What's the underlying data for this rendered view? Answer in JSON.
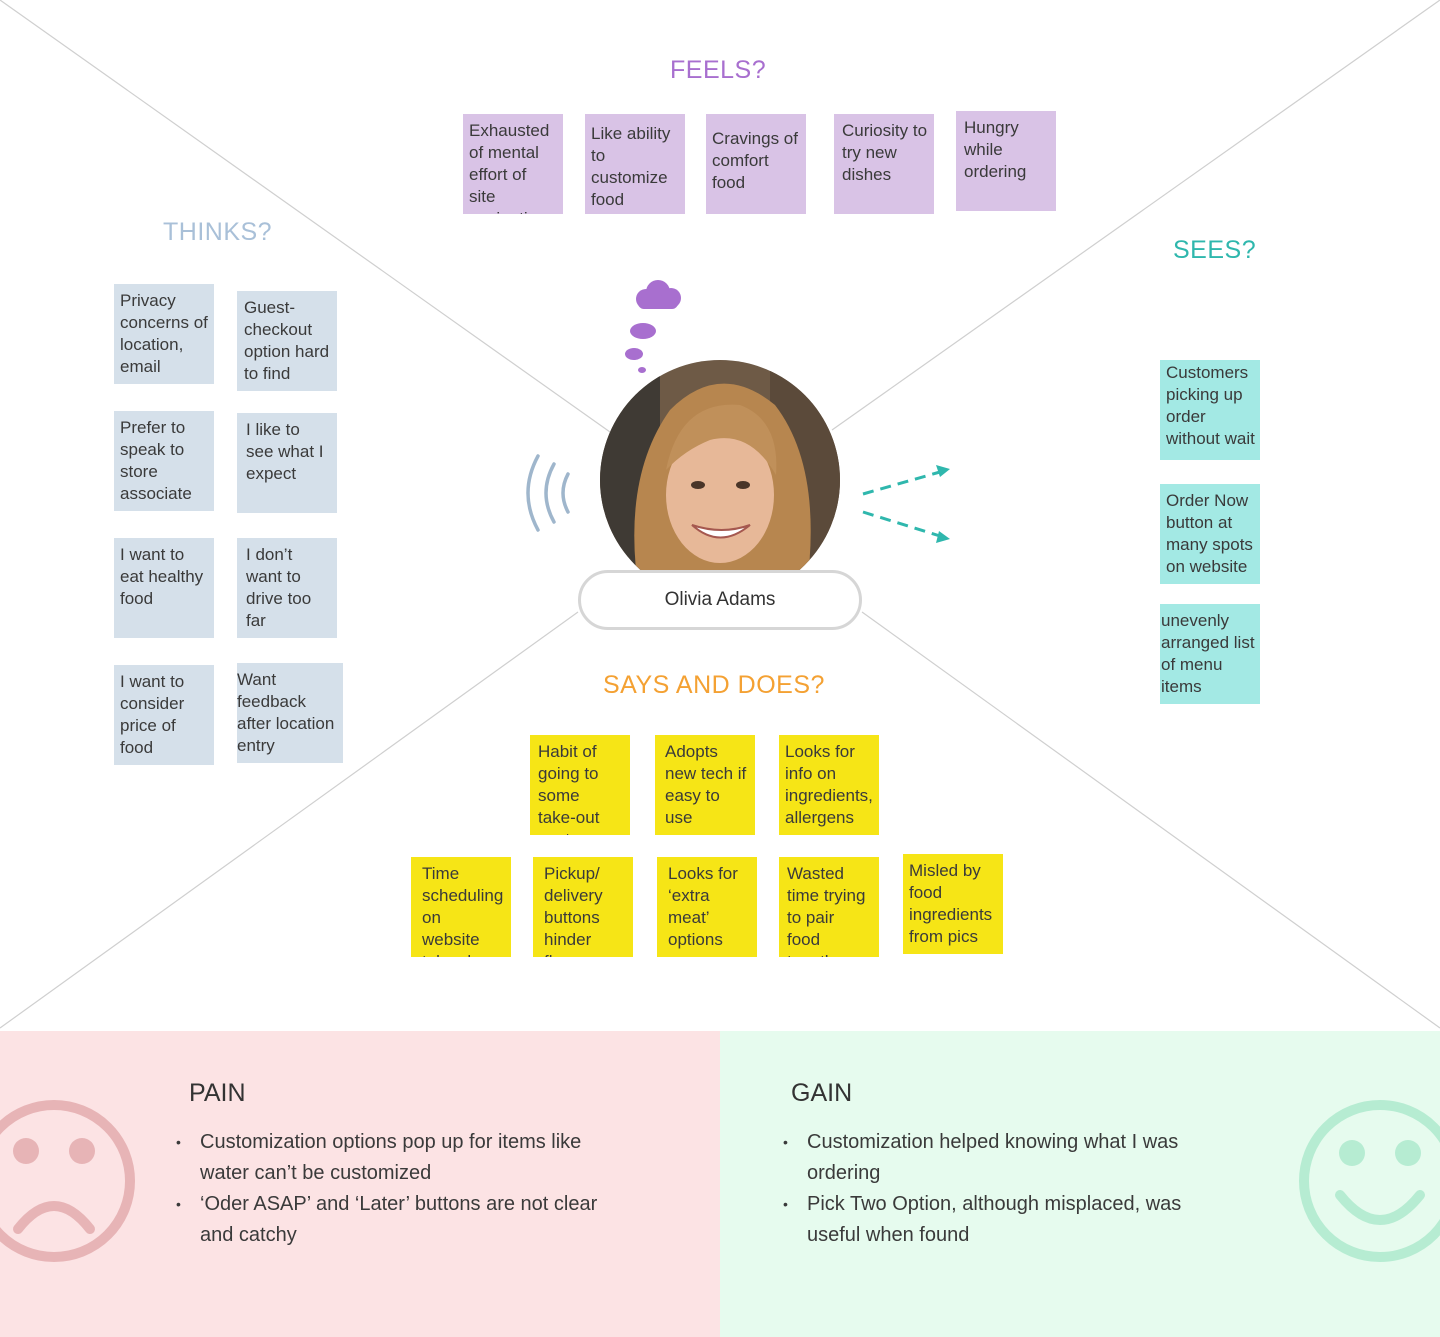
{
  "persona": {
    "name": "Olivia Adams"
  },
  "feels": {
    "title": "FEELS?",
    "notes": [
      "Exhausted of mental effort of site navigation",
      "Like ability to customize food",
      "Cravings of comfort food",
      "Curiosity to try new dishes",
      "Hungry while ordering"
    ]
  },
  "thinks": {
    "title": "THINKS?",
    "notes": [
      "Privacy concerns of location, email",
      "Guest-checkout option hard to find",
      "Prefer to speak to store associate",
      "I like to see what I expect",
      "I want to eat healthy food",
      "I don’t want to drive too far",
      "I want to consider price of food",
      "Want feedback after location entry"
    ]
  },
  "sees": {
    "title": "SEES?",
    "notes": [
      "Customers picking up order without wait",
      "Order Now button at many spots on website",
      "unevenly arranged list of menu items"
    ]
  },
  "says": {
    "title": "SAYS AND DOES?",
    "notes": [
      "Habit of going to some take-out spots",
      "Adopts new tech if easy to use",
      "Looks for info on ingredients, allergens",
      "Time scheduling on website takes long",
      "Pickup/ delivery buttons hinder flow",
      "Looks for ‘extra meat’ options",
      "Wasted time trying to pair food together",
      "Misled by food ingredients from pics"
    ]
  },
  "pain": {
    "title": "PAIN",
    "items": [
      "Customization options pop up for items like water can’t be customized",
      "‘Oder ASAP’ and ‘Later’ buttons are not clear and catchy"
    ]
  },
  "gain": {
    "title": "GAIN",
    "items": [
      "Customization helped knowing what I was ordering",
      "Pick Two Option, although misplaced, was useful when found"
    ]
  },
  "colors": {
    "feels": "#a86fcf",
    "thinks": "#a9c0d8",
    "sees": "#2fb7ad",
    "says": "#f4a133",
    "pain_bg": "#fce3e4",
    "gain_bg": "#e6fbee",
    "sad_face": "#e7b4b6",
    "happy_face": "#b6ecd2"
  }
}
